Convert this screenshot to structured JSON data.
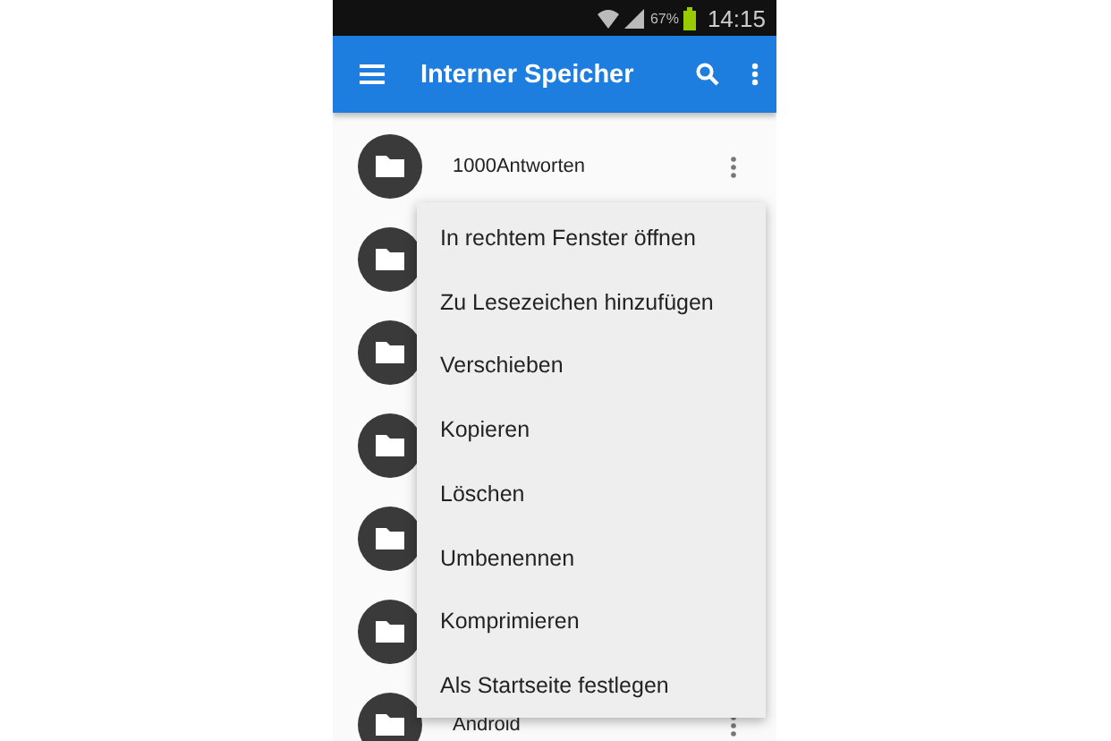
{
  "status_bar": {
    "battery": "67%",
    "time": "14:15"
  },
  "app_bar": {
    "title": "Interner Speicher"
  },
  "folders": [
    {
      "kind": "named",
      "name": "1000Antworten"
    },
    {
      "kind": "covered"
    },
    {
      "kind": "covered"
    },
    {
      "kind": "covered"
    },
    {
      "kind": "covered"
    },
    {
      "kind": "covered"
    },
    {
      "kind": "named",
      "name": "Android"
    }
  ],
  "context_menu": [
    "In rechtem Fenster öffnen",
    "Zu Lesezeichen hinzufügen",
    "Verschieben",
    "Kopieren",
    "Löschen",
    "Umbenennen",
    "Komprimieren",
    "Als Startseite festlegen"
  ]
}
